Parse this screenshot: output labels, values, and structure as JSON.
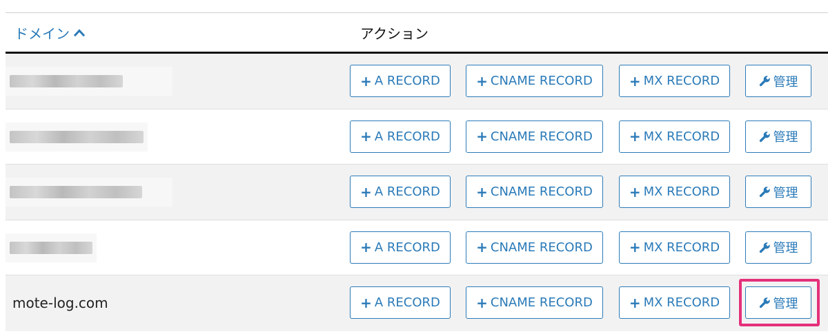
{
  "table": {
    "headers": {
      "domain": "ドメイン",
      "action": "アクション"
    },
    "buttons": {
      "a_record": "A RECORD",
      "cname_record": "CNAME RECORD",
      "mx_record": "MX RECORD",
      "manage": "管理"
    },
    "rows": [
      {
        "domain": "",
        "redacted": true
      },
      {
        "domain": "",
        "redacted": true
      },
      {
        "domain": "",
        "redacted": true
      },
      {
        "domain": "",
        "redacted": true
      },
      {
        "domain": "mote-log.com",
        "redacted": false,
        "highlighted_action": "manage"
      }
    ]
  },
  "colors": {
    "accent": "#2a7ab8",
    "highlight": "#e5307a",
    "header_rule": "#111111"
  },
  "icons": {
    "sort": "chevron-up-icon",
    "add": "plus-icon",
    "manage": "wrench-icon"
  }
}
